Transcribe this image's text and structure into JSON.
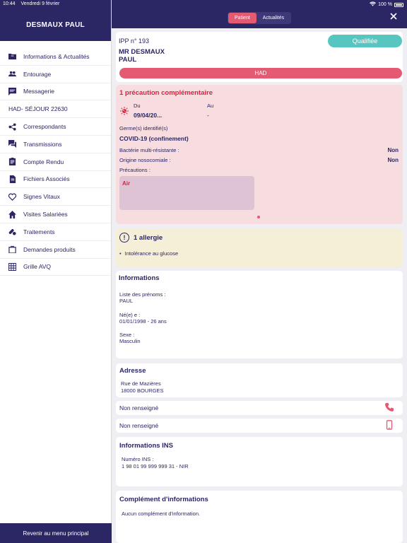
{
  "status_bar": {
    "time": "10:44",
    "date": "Vendredi 9 février",
    "battery": "100 %"
  },
  "sidebar": {
    "patient_name": "DESMAUX PAUL",
    "items": [
      {
        "label": "Informations & Actualités",
        "icon": "folder-icon"
      },
      {
        "label": "Entourage",
        "icon": "people-icon"
      },
      {
        "label": "Messagerie",
        "icon": "message-icon"
      },
      {
        "label": "HAD- SÉJOUR  22630",
        "icon": ""
      },
      {
        "label": "Correspondants",
        "icon": "share-icon"
      },
      {
        "label": "Transmissions",
        "icon": "chat-icon"
      },
      {
        "label": "Compte Rendu",
        "icon": "clipboard-icon"
      },
      {
        "label": "Fichiers Associés",
        "icon": "file-icon"
      },
      {
        "label": "Signes Vitaux",
        "icon": "heart-icon"
      },
      {
        "label": "Visites Salariées",
        "icon": "home-icon"
      },
      {
        "label": "Traitements",
        "icon": "pills-icon"
      },
      {
        "label": "Demandes produits",
        "icon": "bag-icon"
      },
      {
        "label": "Grille AVQ",
        "icon": "grid-icon"
      }
    ],
    "footer": "Revenir au menu principal"
  },
  "header": {
    "tabs": [
      "Patient",
      "Actualités"
    ],
    "active_tab": "Patient"
  },
  "patient": {
    "ipp": "IPP n° 193",
    "name_line1": "MR DESMAUX",
    "name_line2": "PAUL",
    "status": "Qualifiée",
    "care_type": "HAD"
  },
  "precaution": {
    "title": "1 précaution complémentaire",
    "du_label": "Du",
    "du_value": "09/04/20...",
    "au_label": "Au",
    "au_value": "-",
    "germ_label": "Germe(s) identifié(s)",
    "germ_value": "COVID-19 (confinement)",
    "bmr_label": "Bactérie multi-résistante :",
    "bmr_value": "Non",
    "noso_label": "Origine nosocomiale :",
    "noso_value": "Non",
    "precautions_label": "Précautions :",
    "precaution_type": "Air"
  },
  "allergy": {
    "title": "1 allergie",
    "items": [
      "Intolérance au glucose"
    ]
  },
  "informations": {
    "title": "Informations",
    "prenoms_label": "Liste des prénoms :",
    "prenoms_value": "PAUL",
    "born_label": "Né(e) e :",
    "born_value": "01/01/1998 - 26 ans",
    "sex_label": "Sexe :",
    "sex_value": "Masculin"
  },
  "address": {
    "title": "Adresse",
    "line1": "Rue de Mazières",
    "line2": "18000 BOURGES"
  },
  "phone": {
    "landline": "Non renseigné",
    "mobile": "Non renseigné"
  },
  "ins": {
    "title": "Informations INS",
    "number_label": "Numéro INS :",
    "number_value": "1 98 01 99 999 999 31 - NIR"
  },
  "complement": {
    "title": "Complément d'informations",
    "text": "Aucun complément d'information."
  },
  "colors": {
    "navy": "#2b2664",
    "accent": "#e45a72",
    "teal": "#58c6c0",
    "alert_red": "#d8233f"
  }
}
